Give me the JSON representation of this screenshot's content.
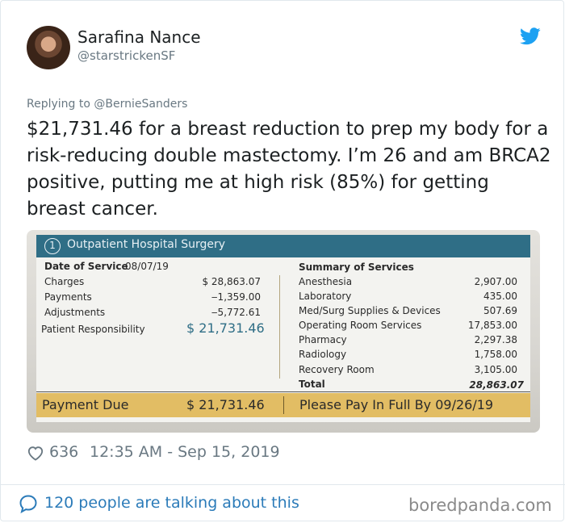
{
  "author": {
    "display_name": "Sarafina Nance",
    "handle": "@starstrickenSF"
  },
  "tweet": {
    "replying_to": "Replying to @BernieSanders",
    "text": "$21,731.46 for a breast reduction to prep my body for a risk-reducing double mastectomy. I’m 26 and am BRCA2 positive, putting me at high risk (85%) for getting breast cancer."
  },
  "bill": {
    "section_number": "1",
    "title": "Outpatient Hospital Surgery",
    "date_label": "Date of Service",
    "date_value": "08/07/19",
    "left_rows": [
      {
        "label": "Charges",
        "amount": "$ 28,863.07"
      },
      {
        "label": "Payments",
        "amount": "‒1,359.00"
      },
      {
        "label": "Adjustments",
        "amount": "‒5,772.61"
      }
    ],
    "patient_responsibility_label": "Patient Responsibility",
    "patient_responsibility_amount": "$ 21,731.46",
    "summary_title": "Summary of Services",
    "services": [
      {
        "label": "Anesthesia",
        "amount": "2,907.00"
      },
      {
        "label": "Laboratory",
        "amount": "435.00"
      },
      {
        "label": "Med/Surg Supplies & Devices",
        "amount": "507.69"
      },
      {
        "label": "Operating Room Services",
        "amount": "17,853.00"
      },
      {
        "label": "Pharmacy",
        "amount": "2,297.38"
      },
      {
        "label": "Radiology",
        "amount": "1,758.00"
      },
      {
        "label": "Recovery Room",
        "amount": "3,105.00"
      }
    ],
    "total_label": "Total",
    "total_amount": "28,863.07",
    "payment_due_label": "Payment Due",
    "payment_due_amount": "$ 21,731.46",
    "pay_by_text": "Please Pay In Full By 09/26/19"
  },
  "meta": {
    "likes": "636",
    "timestamp": "12:35 AM - Sep 15, 2019"
  },
  "footer": {
    "talking_text": "120 people are talking about this",
    "brand": "boredpanda.com"
  },
  "colors": {
    "twitter_blue": "#1da1f2",
    "link_blue": "#2b7bb9",
    "bill_header": "#2f6e86",
    "pay_bar": "#e2bd64"
  }
}
